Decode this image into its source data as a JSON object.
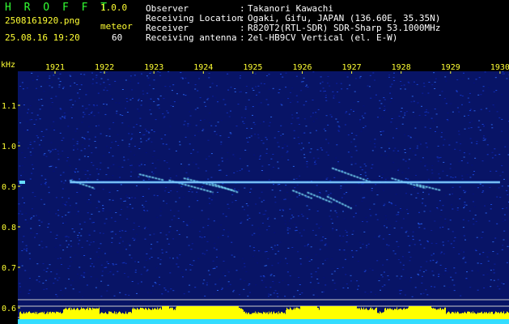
{
  "header": {
    "app_name": "H R O F F T",
    "version": "1.0.0",
    "filename": "2508161920.png",
    "mode": "meteor",
    "datetime": "25.08.16 19:20",
    "count": "60"
  },
  "info": [
    {
      "label": "Observer",
      "value": "Takanori Kawachi"
    },
    {
      "label": "Receiving Location",
      "value": "Ogaki, Gifu, JAPAN (136.60E, 35.35N)"
    },
    {
      "label": "Receiver",
      "value": "R820T2(RTL-SDR) SDR-Sharp 53.1000MHz"
    },
    {
      "label": "Receiving antenna",
      "value": "2el-HB9CV Vertical (el. E-W)"
    }
  ],
  "colors": {
    "background": "#000000",
    "noise": "#0a1a8c",
    "signal": "#66ddff",
    "label": "#ffff33",
    "info_text": "#ffffff",
    "app_name": "#33ff33"
  },
  "chart_data": {
    "type": "heatmap",
    "ylabel": "kHz",
    "x_ticks": [
      "1921",
      "1922",
      "1923",
      "1924",
      "1925",
      "1926",
      "1927",
      "1928",
      "1929",
      "1930"
    ],
    "y_ticks": [
      "1.1",
      "1.0",
      "0.9",
      "0.8",
      "0.7",
      "0.6"
    ],
    "ylim": [
      0.6,
      1.15
    ],
    "carrier_khz": 0.91,
    "carrier_minutes": [
      1921.3,
      1930.0
    ],
    "meteor_traces": [
      {
        "x": [
          1921.3,
          1921.8
        ],
        "y": [
          0.915,
          0.895
        ]
      },
      {
        "x": [
          1922.7,
          1923.2
        ],
        "y": [
          0.93,
          0.915
        ]
      },
      {
        "x": [
          1923.3,
          1924.2
        ],
        "y": [
          0.915,
          0.885
        ]
      },
      {
        "x": [
          1923.6,
          1924.6
        ],
        "y": [
          0.92,
          0.89
        ]
      },
      {
        "x": [
          1924.1,
          1924.7
        ],
        "y": [
          0.91,
          0.885
        ]
      },
      {
        "x": [
          1925.8,
          1926.2
        ],
        "y": [
          0.89,
          0.87
        ]
      },
      {
        "x": [
          1926.1,
          1926.6
        ],
        "y": [
          0.885,
          0.86
        ]
      },
      {
        "x": [
          1926.5,
          1927.0
        ],
        "y": [
          0.875,
          0.845
        ]
      },
      {
        "x": [
          1926.6,
          1927.4
        ],
        "y": [
          0.945,
          0.91
        ]
      },
      {
        "x": [
          1927.8,
          1928.5
        ],
        "y": [
          0.92,
          0.895
        ]
      },
      {
        "x": [
          1928.3,
          1928.8
        ],
        "y": [
          0.905,
          0.89
        ]
      }
    ]
  }
}
